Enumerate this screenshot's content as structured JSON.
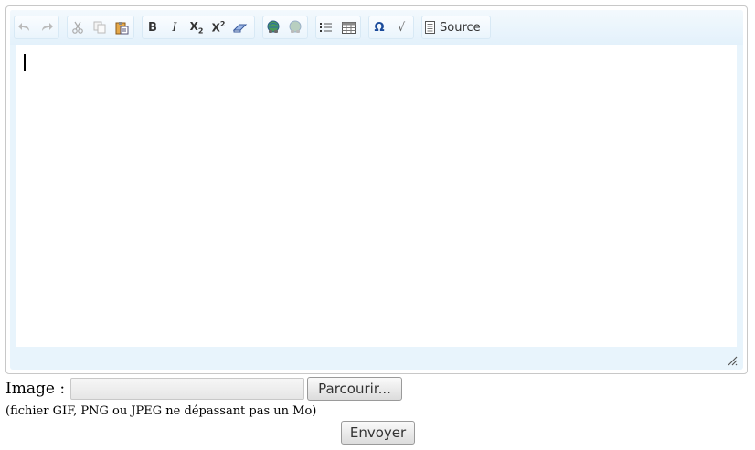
{
  "toolbar": {
    "groups": [
      {
        "items": [
          {
            "icon": "undo-icon"
          },
          {
            "icon": "redo-icon"
          }
        ]
      },
      {
        "items": [
          {
            "icon": "cut-icon"
          },
          {
            "icon": "copy-icon"
          },
          {
            "icon": "paste-icon"
          }
        ]
      },
      {
        "items": [
          {
            "icon": "bold-icon",
            "glyph": "B"
          },
          {
            "icon": "italic-icon",
            "glyph": "I"
          },
          {
            "icon": "subscript-icon",
            "glyph": "X",
            "sub": "2"
          },
          {
            "icon": "superscript-icon",
            "glyph": "X",
            "sup": "2"
          },
          {
            "icon": "remove-format-icon"
          }
        ]
      },
      {
        "items": [
          {
            "icon": "link-icon"
          },
          {
            "icon": "unlink-icon"
          }
        ]
      },
      {
        "items": [
          {
            "icon": "bulleted-list-icon"
          },
          {
            "icon": "table-icon"
          }
        ]
      },
      {
        "items": [
          {
            "icon": "special-char-icon",
            "glyph": "Ω"
          },
          {
            "icon": "math-formula-icon",
            "glyph": "√"
          }
        ]
      }
    ],
    "source_label": "Source"
  },
  "editor": {
    "content": ""
  },
  "upload": {
    "label": "Image :",
    "browse_label": "Parcourir...",
    "hint": "(fichier GIF, PNG ou JPEG ne dépassant pas un Mo)"
  },
  "submit_label": "Envoyer"
}
